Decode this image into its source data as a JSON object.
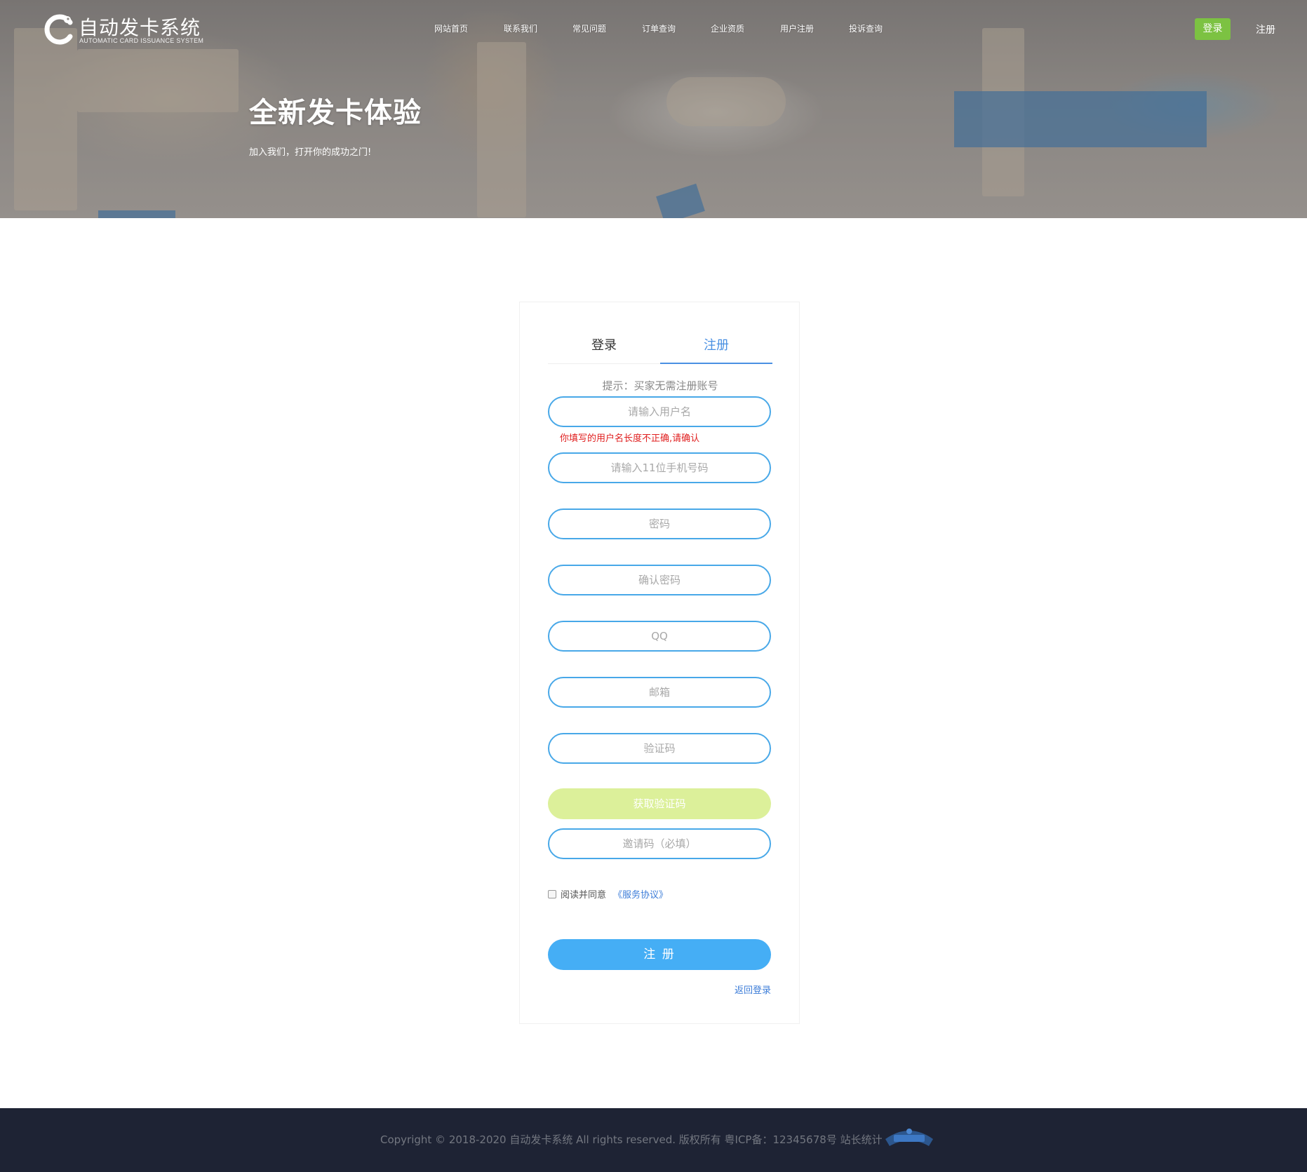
{
  "logo": {
    "title": "自动发卡系统",
    "subtitle": "AUTOMATIC CARD ISSUANCE SYSTEM"
  },
  "nav": {
    "items": [
      "网站首页",
      "联系我们",
      "常见问题",
      "订单查询",
      "企业资质",
      "用户注册",
      "投诉查询"
    ],
    "login_label": "登录",
    "register_label": "注册"
  },
  "hero": {
    "title": "全新发卡体验",
    "subtitle": "加入我们，打开你的成功之门!"
  },
  "form": {
    "tabs": {
      "login": "登录",
      "register": "注册"
    },
    "active_tab": "register",
    "hint": "提示：买家无需注册账号",
    "username": {
      "placeholder": "请输入用户名",
      "value": ""
    },
    "username_error": "你填写的用户名长度不正确,请确认",
    "phone": {
      "placeholder": "请输入11位手机号码",
      "value": ""
    },
    "password": {
      "placeholder": "密码",
      "value": ""
    },
    "confirm_password": {
      "placeholder": "确认密码",
      "value": ""
    },
    "qq": {
      "placeholder": "QQ",
      "value": ""
    },
    "email": {
      "placeholder": "邮箱",
      "value": ""
    },
    "captcha": {
      "placeholder": "验证码",
      "value": ""
    },
    "get_code_label": "获取验证码",
    "invite": {
      "placeholder": "邀请码（必填）",
      "value": ""
    },
    "agree_text": "阅读并同意",
    "agree_link": "《服务协议》",
    "agree_checked": false,
    "submit_label": "注 册",
    "back_label": "返回登录"
  },
  "footer": {
    "copyright": "Copyright © 2018-2020 自动发卡系统 All rights reserved. 版权所有 粤ICP备：12345678号 站长统计"
  },
  "colors": {
    "accent_blue": "#45aef5",
    "field_border": "#48a8e8",
    "login_green": "#7cc242",
    "error_red": "#e02020",
    "footer_bg": "#1e2334"
  }
}
